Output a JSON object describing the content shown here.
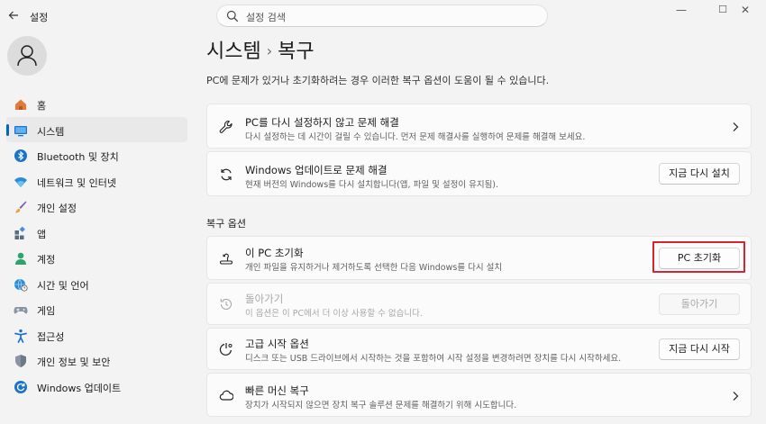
{
  "window": {
    "app_title": "설정",
    "search_placeholder": "설정 검색",
    "controls": {
      "minimize": "—",
      "maximize": "☐",
      "close": "✕"
    }
  },
  "sidebar": {
    "items": [
      {
        "label": "홈",
        "icon": "home-icon",
        "active": false
      },
      {
        "label": "시스템",
        "icon": "system-icon",
        "active": true
      },
      {
        "label": "Bluetooth 및 장치",
        "icon": "bluetooth-icon",
        "active": false
      },
      {
        "label": "네트워크 및 인터넷",
        "icon": "network-icon",
        "active": false
      },
      {
        "label": "개인 설정",
        "icon": "brush-icon",
        "active": false
      },
      {
        "label": "앱",
        "icon": "apps-icon",
        "active": false
      },
      {
        "label": "계정",
        "icon": "account-icon",
        "active": false
      },
      {
        "label": "시간 및 언어",
        "icon": "globe-clock-icon",
        "active": false
      },
      {
        "label": "게임",
        "icon": "gamepad-icon",
        "active": false
      },
      {
        "label": "접근성",
        "icon": "accessibility-icon",
        "active": false
      },
      {
        "label": "개인 정보 및 보안",
        "icon": "shield-icon",
        "active": false
      },
      {
        "label": "Windows 업데이트",
        "icon": "update-icon",
        "active": false
      }
    ]
  },
  "main": {
    "breadcrumb_parent": "시스템",
    "breadcrumb_sep": "›",
    "breadcrumb_current": "복구",
    "description": "PC에 문제가 있거나 초기화하려는 경우 이러한 복구 옵션이 도움이 될 수 있습니다.",
    "cards": {
      "troubleshoot": {
        "title": "PC를 다시 설정하지 않고 문제 해결",
        "subtitle": "다시 설정하는 데 시간이 걸릴 수 있습니다. 먼저 문제 해결사를 실행하여 문제를 해결해 보세요.",
        "icon": "wrench-icon"
      },
      "windows_update_fix": {
        "title": "Windows 업데이트로 문제 해결",
        "subtitle": "현재 버전의 Windows를 다시 설치합니다(앱, 파일 및 설정이 유지됨).",
        "button": "지금 다시 설치",
        "icon": "refresh-icon"
      }
    },
    "section_title": "복구 옵션",
    "options": {
      "reset_pc": {
        "title": "이 PC 초기화",
        "subtitle": "개인 파일을 유지하거나 제거하도록 선택한 다음 Windows를 다시 설치",
        "button": "PC 초기화",
        "icon": "reset-pc-icon"
      },
      "go_back": {
        "title": "돌아가기",
        "subtitle": "이 옵션은 이 PC에서 더 이상 사용할 수 없습니다.",
        "button": "돌아가기",
        "icon": "history-icon",
        "disabled": true
      },
      "advanced_startup": {
        "title": "고급 시작 옵션",
        "subtitle": "디스크 또는 USB 드라이브에서 시작하는 것을 포함하여 시작 설정을 변경하려면 장치를 다시 시작하세요.",
        "button": "지금 다시 시작",
        "icon": "advanced-startup-icon"
      },
      "quick_machine_recovery": {
        "title": "빠른 머신 복구",
        "subtitle": "장치가 시작되지 않으면 장치 복구 솔루션 문제를 해결하기 위해 시도합니다.",
        "icon": "cloud-icon"
      }
    }
  },
  "colors": {
    "accent": "#0067c0",
    "highlight_box": "#d9232e",
    "background": "#f3f3f3",
    "card": "#fbfbfb"
  }
}
